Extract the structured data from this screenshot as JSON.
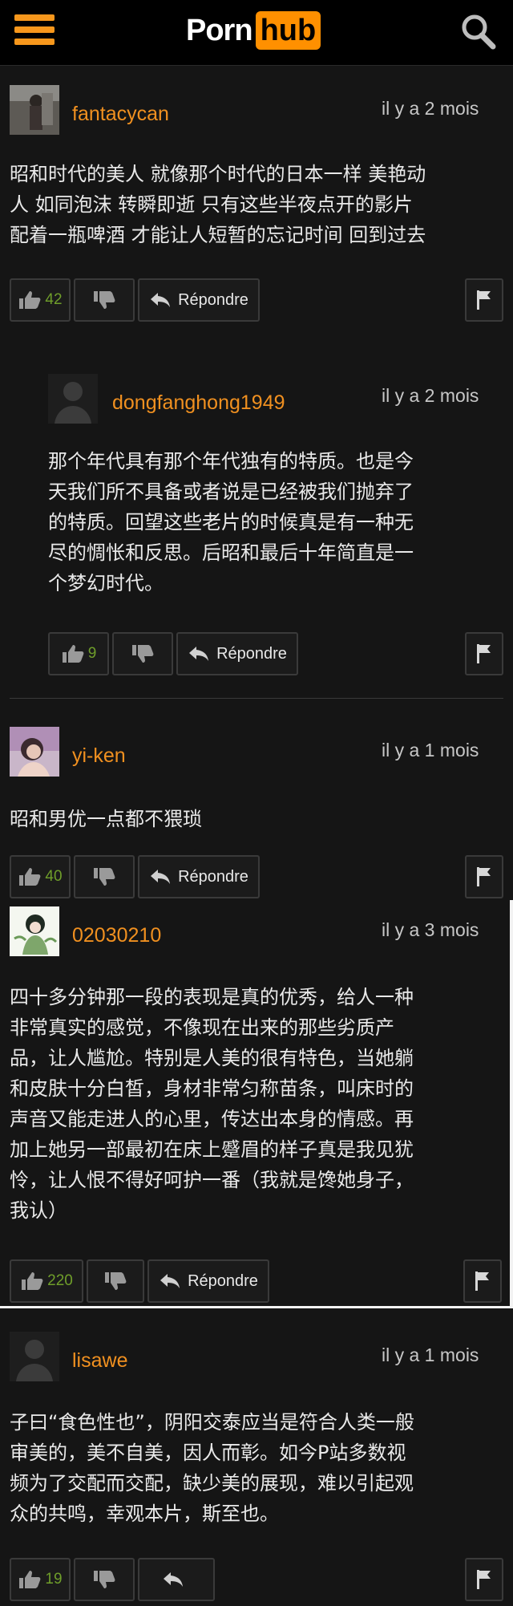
{
  "header": {
    "logo_porn": "Porn",
    "logo_hub": "hub",
    "brand_color": "#ff9000"
  },
  "comments": [
    {
      "username": "fantacycan",
      "date": "il y a 2 mois",
      "lines": [
        "昭和时代的美人 就像那个时代的日本一样 美艳动",
        "人 如同泡沫 转瞬即逝 只有这些半夜点开的影片",
        "配着一瓶啤酒 才能让人短暂的忘记时间 回到过去"
      ],
      "likes": "42",
      "reply_label": "Répondre"
    },
    {
      "username": "dongfanghong1949",
      "date": "il y a 2 mois",
      "lines": [
        "那个年代具有那个年代独有的特质。也是今",
        "天我们所不具备或者说是已经被我们抛弃了",
        "的特质。回望这些老片的时候真是有一种无",
        "尽的惆怅和反思。后昭和最后十年简直是一",
        "个梦幻时代。"
      ],
      "likes": "9",
      "reply_label": "Répondre"
    },
    {
      "username": "yi-ken",
      "date": "il y a 1 mois",
      "lines": [
        "昭和男优一点都不猥琐"
      ],
      "likes": "40",
      "reply_label": "Répondre"
    },
    {
      "username": "02030210",
      "date": "il y a 3 mois",
      "lines": [
        "四十多分钟那一段的表现是真的优秀，给人一种",
        "非常真实的感觉，不像现在出来的那些劣质产",
        "品，让人尴尬。特别是人美的很有特色，当她躺",
        "和皮肤十分白皙，身材非常匀称苗条，叫床时的",
        "声音又能走进人的心里，传达出本身的情感。再",
        "加上她另一部最初在床上蹙眉的样子真是我见犹",
        "怜，让人恨不得好呵护一番（我就是馋她身子，",
        "我认）"
      ],
      "likes": "220",
      "reply_label": "Répondre"
    },
    {
      "username": "lisawe",
      "date": "il y a 1 mois",
      "lines": [
        "子曰“食色性也”，阴阳交泰应当是符合人类一般",
        "审美的，美不自美，因人而彰。如今P站多数视",
        "频为了交配而交配，缺少美的展现，难以引起观",
        "众的共鸣，幸观本片，斯至也。"
      ],
      "likes": "19",
      "reply_label": ""
    }
  ],
  "icons": {
    "menu": "hamburger-icon",
    "search": "search-icon",
    "like": "thumbs-up-icon",
    "dislike": "thumbs-down-icon",
    "reply": "reply-arrow-icon",
    "flag": "flag-icon"
  },
  "colors": {
    "background": "#151515",
    "username": "#f09020",
    "like_count": "#6f9e2a"
  }
}
